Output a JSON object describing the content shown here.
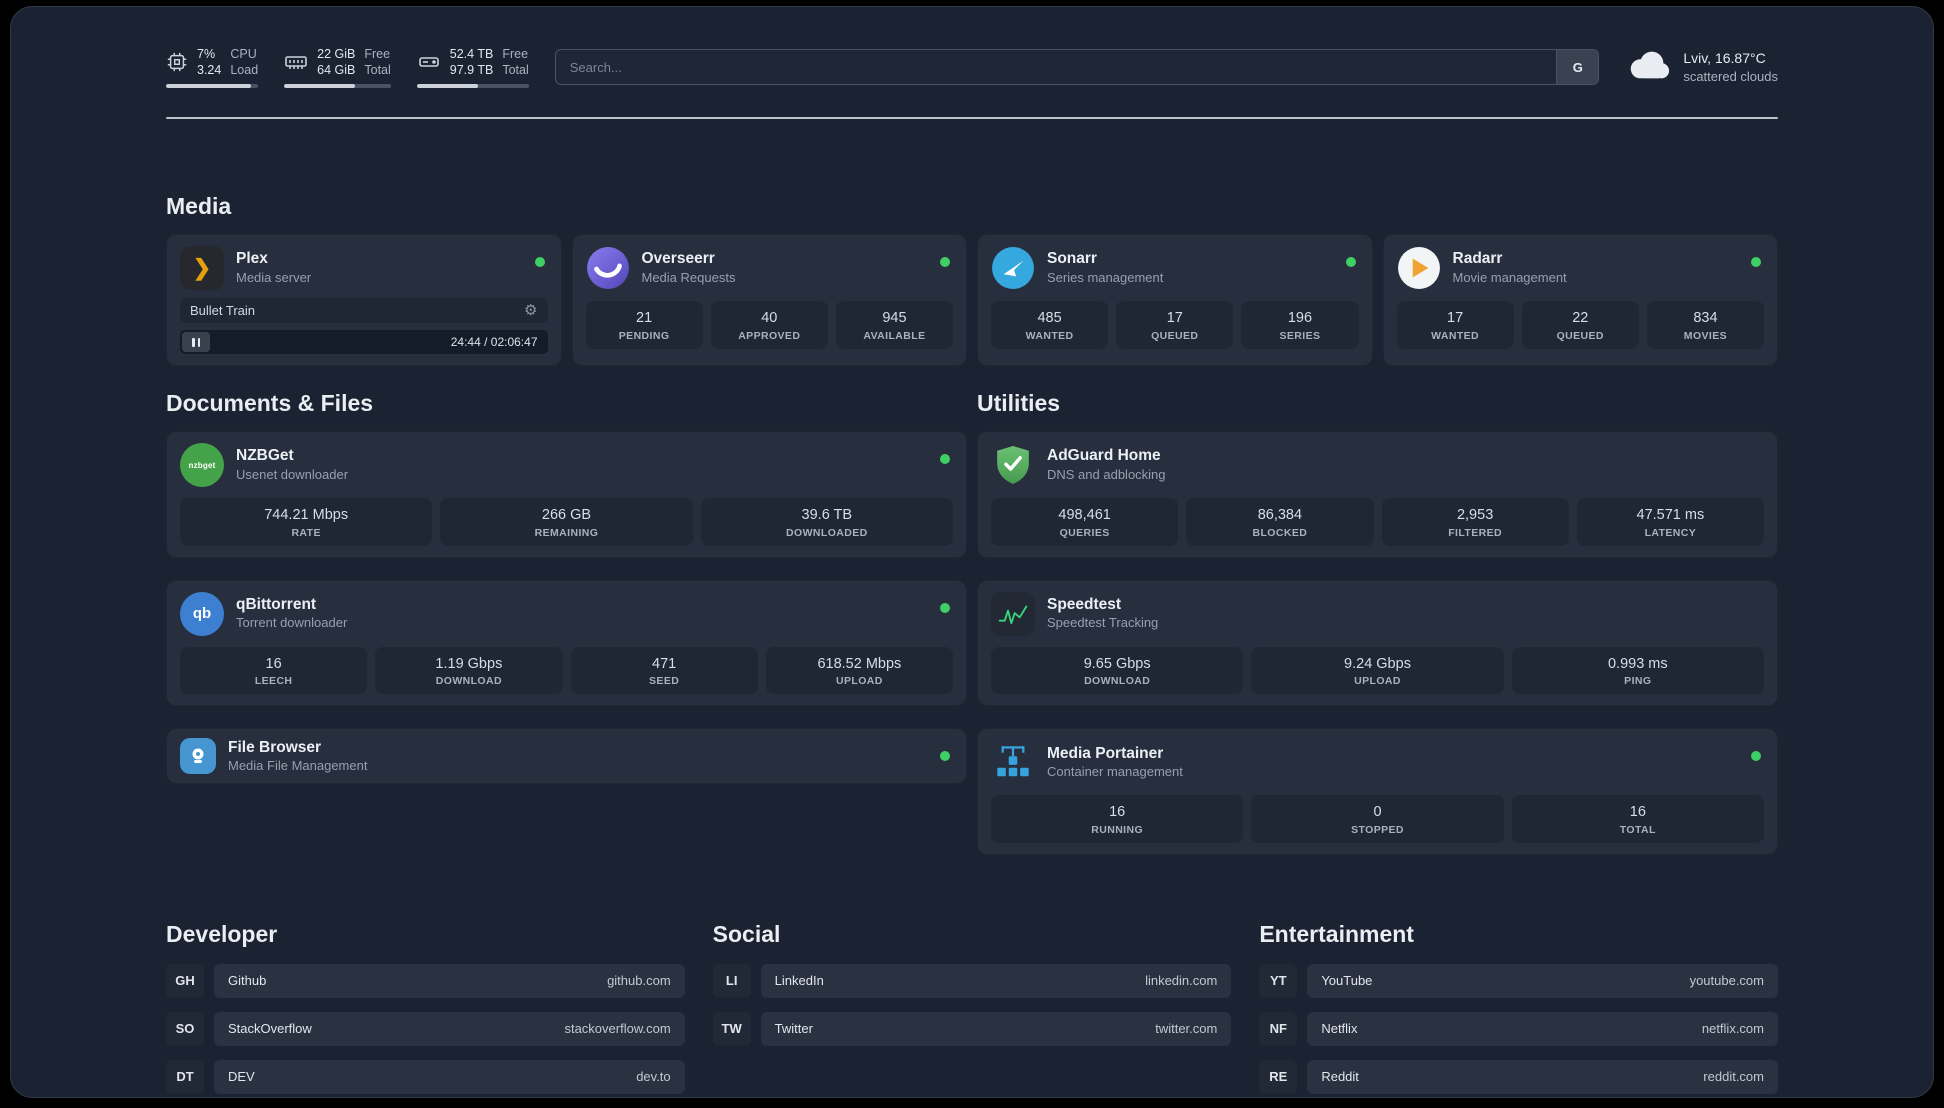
{
  "header": {
    "cpu": {
      "values": [
        "7%",
        "3.24"
      ],
      "labels": [
        "CPU",
        "Load"
      ],
      "progress": 92
    },
    "ram": {
      "values": [
        "22 GiB",
        "64 GiB"
      ],
      "labels": [
        "Free",
        "Total"
      ],
      "progress": 66
    },
    "disk": {
      "values": [
        "52.4 TB",
        "97.9 TB"
      ],
      "labels": [
        "Free",
        "Total"
      ],
      "progress": 55
    },
    "search": {
      "placeholder": "Search...",
      "button_label": "G"
    },
    "weather": {
      "location": "Lviv, 16.87°C",
      "condition": "scattered clouds"
    }
  },
  "sections": {
    "media": {
      "title": "Media",
      "plex": {
        "name": "Plex",
        "subtitle": "Media server",
        "now_playing": {
          "title": "Bullet Train",
          "time": "24:44 / 02:06:47"
        }
      },
      "overseerr": {
        "name": "Overseerr",
        "subtitle": "Media Requests",
        "stats": [
          {
            "value": "21",
            "label": "PENDING"
          },
          {
            "value": "40",
            "label": "APPROVED"
          },
          {
            "value": "945",
            "label": "AVAILABLE"
          }
        ]
      },
      "sonarr": {
        "name": "Sonarr",
        "subtitle": "Series management",
        "stats": [
          {
            "value": "485",
            "label": "WANTED"
          },
          {
            "value": "17",
            "label": "QUEUED"
          },
          {
            "value": "196",
            "label": "SERIES"
          }
        ]
      },
      "radarr": {
        "name": "Radarr",
        "subtitle": "Movie management",
        "stats": [
          {
            "value": "17",
            "label": "WANTED"
          },
          {
            "value": "22",
            "label": "QUEUED"
          },
          {
            "value": "834",
            "label": "MOVIES"
          }
        ]
      }
    },
    "documents": {
      "title": "Documents & Files",
      "nzbget": {
        "name": "NZBGet",
        "subtitle": "Usenet downloader",
        "icon_text": "nzbget",
        "stats": [
          {
            "value": "744.21 Mbps",
            "label": "RATE"
          },
          {
            "value": "266 GB",
            "label": "REMAINING"
          },
          {
            "value": "39.6 TB",
            "label": "DOWNLOADED"
          }
        ]
      },
      "qbittorrent": {
        "name": "qBittorrent",
        "subtitle": "Torrent downloader",
        "icon_text": "qb",
        "stats": [
          {
            "value": "16",
            "label": "LEECH"
          },
          {
            "value": "1.19 Gbps",
            "label": "DOWNLOAD"
          },
          {
            "value": "471",
            "label": "SEED"
          },
          {
            "value": "618.52 Mbps",
            "label": "UPLOAD"
          }
        ]
      },
      "filebrowser": {
        "name": "File Browser",
        "subtitle": "Media File Management"
      }
    },
    "utilities": {
      "title": "Utilities",
      "adguard": {
        "name": "AdGuard Home",
        "subtitle": "DNS and adblocking",
        "stats": [
          {
            "value": "498,461",
            "label": "QUERIES"
          },
          {
            "value": "86,384",
            "label": "BLOCKED"
          },
          {
            "value": "2,953",
            "label": "FILTERED"
          },
          {
            "value": "47.571 ms",
            "label": "LATENCY"
          }
        ]
      },
      "speedtest": {
        "name": "Speedtest",
        "subtitle": "Speedtest Tracking",
        "stats": [
          {
            "value": "9.65 Gbps",
            "label": "DOWNLOAD"
          },
          {
            "value": "9.24 Gbps",
            "label": "UPLOAD"
          },
          {
            "value": "0.993 ms",
            "label": "PING"
          }
        ]
      },
      "portainer": {
        "name": "Media Portainer",
        "subtitle": "Container management",
        "stats": [
          {
            "value": "16",
            "label": "RUNNING"
          },
          {
            "value": "0",
            "label": "STOPPED"
          },
          {
            "value": "16",
            "label": "TOTAL"
          }
        ]
      }
    },
    "bookmarks": [
      {
        "title": "Developer",
        "items": [
          {
            "abbr": "GH",
            "name": "Github",
            "url": "github.com"
          },
          {
            "abbr": "SO",
            "name": "StackOverflow",
            "url": "stackoverflow.com"
          },
          {
            "abbr": "DT",
            "name": "DEV",
            "url": "dev.to"
          }
        ]
      },
      {
        "title": "Social",
        "items": [
          {
            "abbr": "LI",
            "name": "LinkedIn",
            "url": "linkedin.com"
          },
          {
            "abbr": "TW",
            "name": "Twitter",
            "url": "twitter.com"
          }
        ]
      },
      {
        "title": "Entertainment",
        "items": [
          {
            "abbr": "YT",
            "name": "YouTube",
            "url": "youtube.com"
          },
          {
            "abbr": "NF",
            "name": "Netflix",
            "url": "netflix.com"
          },
          {
            "abbr": "RE",
            "name": "Reddit",
            "url": "reddit.com"
          }
        ]
      }
    ]
  },
  "colors": {
    "accent_green": "#3ed065",
    "panel": "#1b2231",
    "card": "#272e3d",
    "tile": "#1f2735"
  }
}
